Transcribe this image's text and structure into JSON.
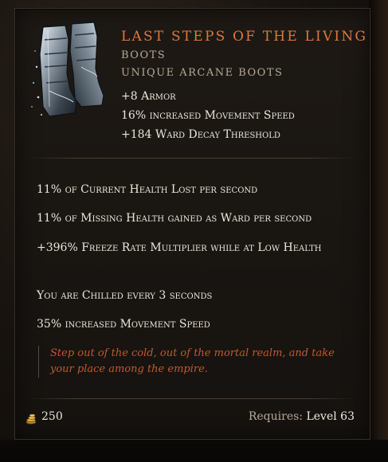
{
  "tooltip": {
    "icon": "arcane-boots-icon",
    "name": "LAST STEPS OF THE LIVING",
    "type": "BOOTS",
    "subtype": "UNIQUE ARCANE BOOTS",
    "implicits": [
      "+8 Armor",
      "16% increased Movement Speed",
      "+184 Ward Decay Threshold"
    ],
    "mods": [
      "11% of Current Health Lost per second",
      "11% of Missing Health gained as Ward per second",
      "+396% Freeze Rate Multiplier while at Low Health",
      "You are Chilled every 3 seconds",
      "35% increased Movement Speed"
    ],
    "lore": "Step out of the cold, out of the mortal realm, and take your place among the empire.",
    "footer": {
      "gold_icon": "gold-coins-icon",
      "gold_value": "250",
      "requires_label": "Requires:",
      "requires_level": "Level 63"
    }
  },
  "colors": {
    "unique_name": "#e0773a",
    "lore": "#c05a2c",
    "text": "#ece6da",
    "muted": "#b7a998"
  }
}
